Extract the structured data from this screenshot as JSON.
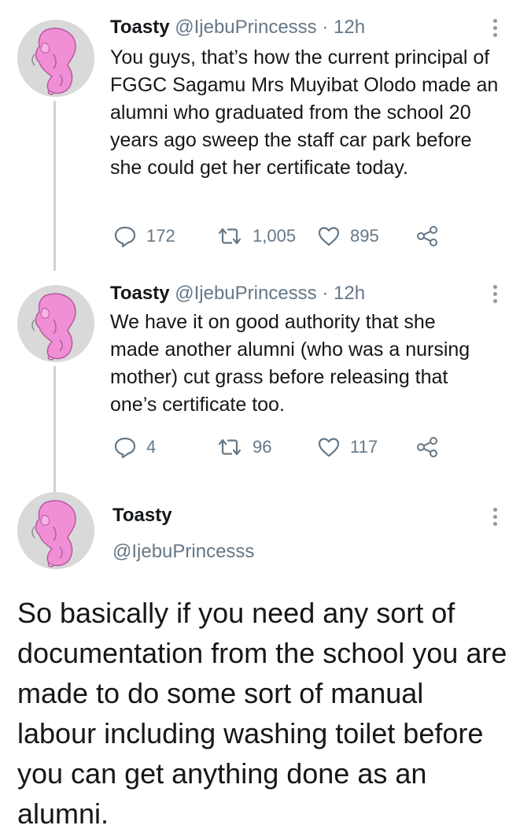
{
  "tweets": [
    {
      "name": "Toasty",
      "handle": "@IjebuPrincesss",
      "sep": "·",
      "time": "12h",
      "text": "You guys, that’s how the current principal of FGGC Sagamu Mrs Muyibat Olodo made an alumni who graduated from the school 20 years ago sweep the staff car park before she could get her certificate today.",
      "replies": "172",
      "retweets": "1,005",
      "likes": "895"
    },
    {
      "name": "Toasty",
      "handle": "@IjebuPrincesss",
      "sep": "·",
      "time": "12h",
      "text": "We have it on good authority that she made another alumni (who was a nursing mother) cut grass before releasing that one’s certificate too.",
      "replies": "4",
      "retweets": "96",
      "likes": "117"
    }
  ],
  "main_tweet": {
    "name": "Toasty",
    "handle": "@IjebuPrincesss",
    "text": "So basically if you need any sort of documentation from the school you are made to do some sort of manual labour including washing toilet before you can get anything done as an alumni."
  },
  "icons": {
    "reply": "reply-icon",
    "retweet": "retweet-icon",
    "like": "heart-icon",
    "share": "share-icon",
    "more": "more-vertical-icon"
  },
  "colors": {
    "text": "#14171a",
    "secondary": "#657786",
    "thread_line": "#c9d3db",
    "avatar_figure": "#f08fd6"
  }
}
